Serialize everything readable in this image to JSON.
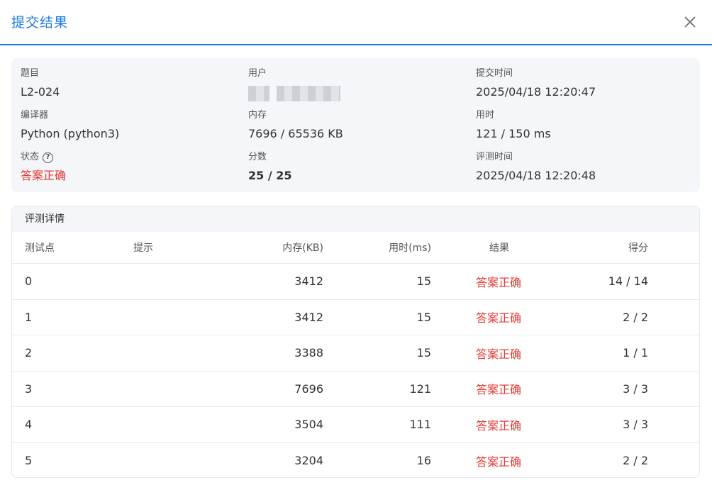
{
  "header": {
    "title": "提交结果"
  },
  "info": {
    "problem": {
      "label": "题目",
      "value": "L2-024"
    },
    "user": {
      "label": "用户"
    },
    "submit_time": {
      "label": "提交时间",
      "value": "2025/04/18 12:20:47"
    },
    "compiler": {
      "label": "编译器",
      "value": "Python (python3)"
    },
    "memory": {
      "label": "内存",
      "value": "7696 / 65536 KB"
    },
    "time": {
      "label": "用时",
      "value": "121 / 150 ms"
    },
    "status": {
      "label": "状态",
      "value": "答案正确"
    },
    "score": {
      "label": "分数",
      "value": "25 / 25"
    },
    "judge_time": {
      "label": "评测时间",
      "value": "2025/04/18 12:20:48"
    }
  },
  "detail": {
    "title": "评测详情",
    "columns": {
      "id": "测试点",
      "hint": "提示",
      "memory": "内存(KB)",
      "time": "用时(ms)",
      "result": "结果",
      "score": "得分"
    },
    "rows": [
      {
        "id": "0",
        "hint": "",
        "memory": "3412",
        "time": "15",
        "result": "答案正确",
        "score": "14 / 14"
      },
      {
        "id": "1",
        "hint": "",
        "memory": "3412",
        "time": "15",
        "result": "答案正确",
        "score": "2 / 2"
      },
      {
        "id": "2",
        "hint": "",
        "memory": "3388",
        "time": "15",
        "result": "答案正确",
        "score": "1 / 1"
      },
      {
        "id": "3",
        "hint": "",
        "memory": "7696",
        "time": "121",
        "result": "答案正确",
        "score": "3 / 3"
      },
      {
        "id": "4",
        "hint": "",
        "memory": "3504",
        "time": "111",
        "result": "答案正确",
        "score": "3 / 3"
      },
      {
        "id": "5",
        "hint": "",
        "memory": "3204",
        "time": "16",
        "result": "答案正确",
        "score": "2 / 2"
      }
    ]
  },
  "colors": {
    "accent": "#1f7ae0",
    "accepted": "#e53935"
  },
  "icons": {
    "close": "close-icon",
    "help": "question-circle-icon"
  }
}
